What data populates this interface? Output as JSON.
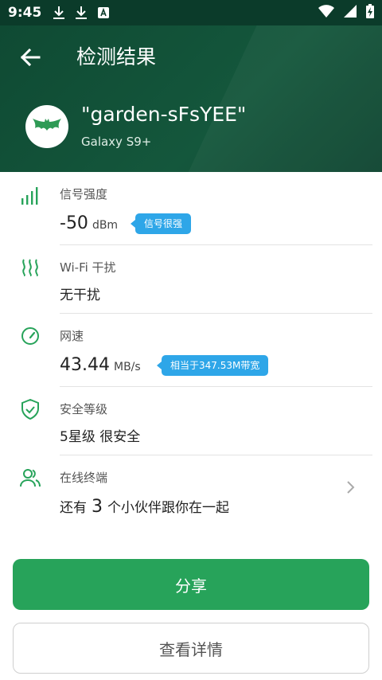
{
  "status_bar": {
    "time": "9:45",
    "icons": [
      "download-icon",
      "download-icon",
      "a-notification-icon",
      "wifi-icon",
      "cellular-icon",
      "battery-charging-icon"
    ]
  },
  "header": {
    "back_icon": "arrow-left-icon",
    "title": "检测结果",
    "network_name": "\"garden-sFsYEE\"",
    "device_name": "Galaxy S9+",
    "logo_icon": "bat-logo-icon"
  },
  "items": {
    "signal": {
      "icon": "signal-bars-icon",
      "label": "信号强度",
      "value": "-50",
      "unit": "dBm",
      "badge": "信号很强"
    },
    "interference": {
      "icon": "wave-icon",
      "label": "Wi-Fi 干扰",
      "value": "无干扰"
    },
    "speed": {
      "icon": "speedometer-icon",
      "label": "网速",
      "value": "43.44",
      "unit": "MB/s",
      "badge": "相当于347.53M带宽"
    },
    "security": {
      "icon": "shield-check-icon",
      "label": "安全等级",
      "value": "5星级 很安全"
    },
    "devices": {
      "icon": "users-icon",
      "label": "在线终端",
      "prefix": "还有",
      "count": "3",
      "suffix": "个小伙伴跟你在一起"
    }
  },
  "buttons": {
    "share": "分享",
    "details": "查看详情"
  },
  "colors": {
    "header_bg": "#0f4a33",
    "accent_green": "#27a35a",
    "badge_blue": "#2ea6e8"
  }
}
